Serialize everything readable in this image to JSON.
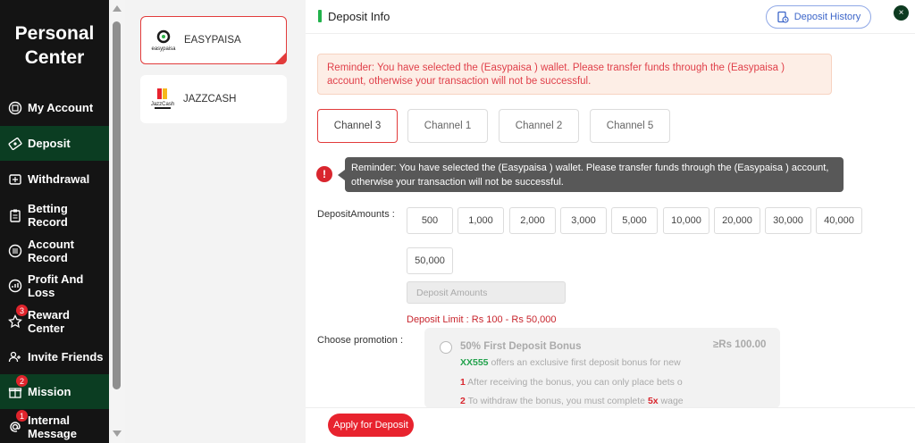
{
  "sidebar": {
    "title_line1": "Personal",
    "title_line2": "Center",
    "items": [
      {
        "label": "My Account",
        "icon": "account-icon"
      },
      {
        "label": "Deposit",
        "icon": "deposit-icon"
      },
      {
        "label": "Withdrawal",
        "icon": "withdrawal-icon"
      },
      {
        "label": "Betting Record",
        "icon": "clipboard-icon"
      },
      {
        "label": "Account Record",
        "icon": "record-icon"
      },
      {
        "label": "Profit And Loss",
        "icon": "chart-icon"
      },
      {
        "label": "Reward Center",
        "icon": "star-icon",
        "badge": "3"
      },
      {
        "label": "Invite Friends",
        "icon": "people-icon"
      },
      {
        "label": "Mission",
        "icon": "gift-icon",
        "badge": "2"
      },
      {
        "label": "Internal Message",
        "icon": "at-icon",
        "badge": "1"
      }
    ]
  },
  "wallets": [
    {
      "label": "EASYPAISA",
      "logo_text": "easypaisa",
      "selected": true
    },
    {
      "label": "JAZZCASH",
      "logo_text": "JazzCash",
      "selected": false
    }
  ],
  "header": {
    "title": "Deposit Info",
    "history_label": "Deposit History",
    "close_label": "×"
  },
  "reminder": "Reminder: You have selected the (Easypaisa ) wallet. Please transfer funds through the (Easypaisa ) account, otherwise your transaction will not be successful.",
  "channels": [
    "Channel 3",
    "Channel 1",
    "Channel 2",
    "Channel 5"
  ],
  "tooltip": {
    "icon": "!",
    "text": "Reminder: You have selected the (Easypaisa ) wallet. Please transfer funds through the (Easypaisa ) account, otherwise your transaction will not be successful."
  },
  "deposit": {
    "amounts_label": "DepositAmounts :",
    "amounts": [
      "500",
      "1,000",
      "2,000",
      "3,000",
      "5,000",
      "10,000",
      "20,000",
      "30,000",
      "40,000",
      "50,000"
    ],
    "input_placeholder": "Deposit Amounts",
    "limit_text": "Deposit Limit :  Rs  100  - Rs  50,000"
  },
  "promotion": {
    "label": "Choose promotion :",
    "title": "50% First Deposit Bonus",
    "min_text": "≥Rs  100.00",
    "brand": "XX555",
    "desc": " offers an exclusive first deposit bonus for new",
    "rule1_num": "1",
    "rule1": " After receiving the bonus, you can only place bets o",
    "rule2_num": "2",
    "rule2_pre": " To withdraw the bonus, you must complete ",
    "rule2_mult": "5x",
    "rule2_post": " wage"
  },
  "footer": {
    "apply_label": "Apply for Deposit"
  },
  "colors": {
    "accent_red": "#e8232e",
    "sidebar_active": "#0b3d22",
    "green_bar": "#22b24c",
    "link_blue": "#3d66c9"
  }
}
